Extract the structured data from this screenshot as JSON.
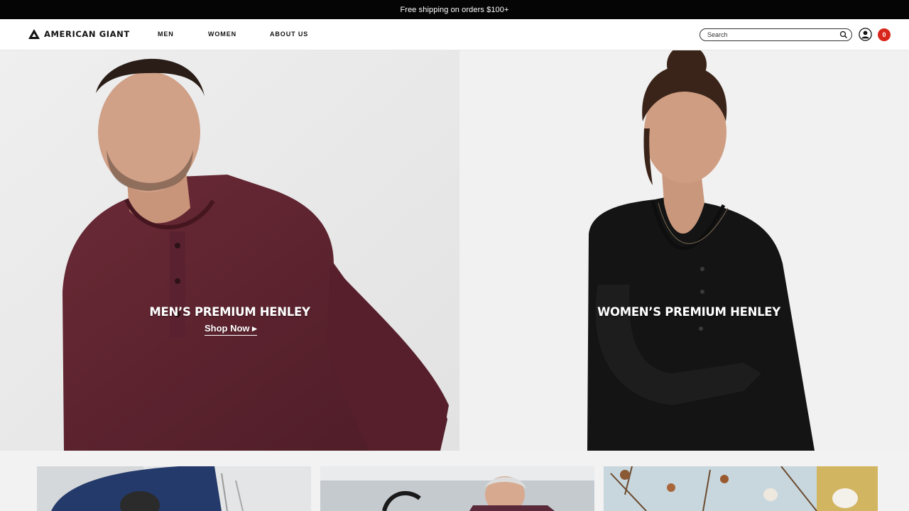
{
  "announcement": {
    "text": "Free shipping on orders $100+"
  },
  "header": {
    "logo_text": "AMERICAN GIANT",
    "nav": [
      {
        "label": "MEN"
      },
      {
        "label": "WOMEN"
      },
      {
        "label": "ABOUT US"
      }
    ],
    "search": {
      "placeholder": "Search",
      "icon": "search-icon"
    },
    "account_icon": "user-icon",
    "cart": {
      "count": "0",
      "color": "#d8261c"
    }
  },
  "hero": {
    "men": {
      "title": "MEN’S PREMIUM HENLEY",
      "cta": "Shop Now ▸",
      "shirt_color": "#5e2430"
    },
    "women": {
      "title": "WOMEN’S PREMIUM HENLEY",
      "shirt_color": "#141414"
    }
  },
  "tiles": [
    {
      "name": "tile-men-working"
    },
    {
      "name": "tile-factory-worker"
    },
    {
      "name": "tile-cotton-field"
    }
  ]
}
